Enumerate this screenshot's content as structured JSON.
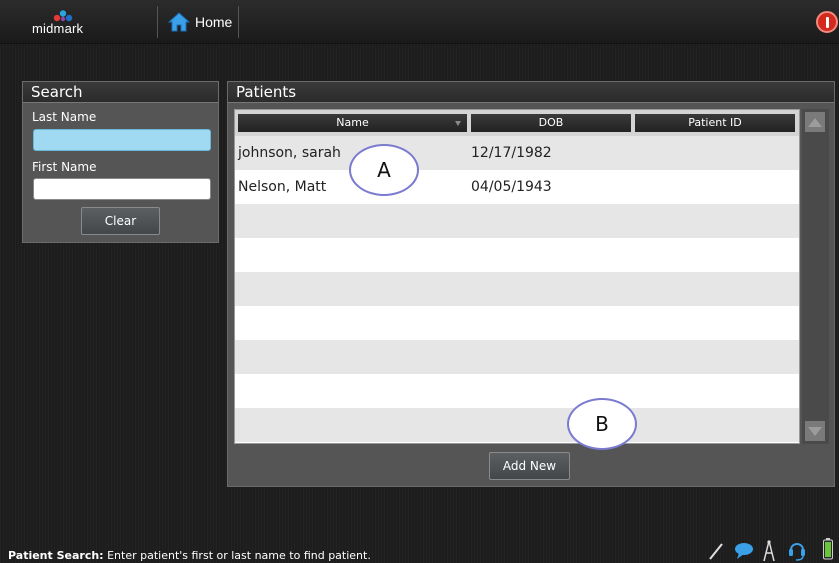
{
  "topbar": {
    "logo_text": "midmark",
    "home_label": "Home"
  },
  "search": {
    "title": "Search",
    "last_name_label": "Last Name",
    "last_name_value": "",
    "first_name_label": "First Name",
    "first_name_value": "",
    "clear_label": "Clear"
  },
  "patients": {
    "title": "Patients",
    "columns": [
      "Name",
      "DOB",
      "Patient ID"
    ],
    "rows": [
      {
        "name": "johnson, sarah",
        "dob": "12/17/1982",
        "patient_id": ""
      },
      {
        "name": "Nelson, Matt",
        "dob": "04/05/1943",
        "patient_id": ""
      },
      {
        "name": "",
        "dob": "",
        "patient_id": ""
      },
      {
        "name": "",
        "dob": "",
        "patient_id": ""
      },
      {
        "name": "",
        "dob": "",
        "patient_id": ""
      },
      {
        "name": "",
        "dob": "",
        "patient_id": ""
      },
      {
        "name": "",
        "dob": "",
        "patient_id": ""
      },
      {
        "name": "",
        "dob": "",
        "patient_id": ""
      },
      {
        "name": "",
        "dob": "",
        "patient_id": ""
      }
    ],
    "add_new_label": "Add New"
  },
  "callouts": {
    "a": "A",
    "b": "B"
  },
  "status": {
    "prefix": "Patient Search:",
    "message": " Enter patient's first or last name to find patient."
  },
  "colors": {
    "active_field": "#9fd9f2",
    "alert": "#d42a1e",
    "battery": "#6cc43a",
    "callout_border": "#7a7ad0"
  },
  "icons": [
    "home-icon",
    "alert-icon",
    "pen-icon",
    "chat-icon",
    "antenna-icon",
    "headset-icon",
    "battery-icon"
  ]
}
